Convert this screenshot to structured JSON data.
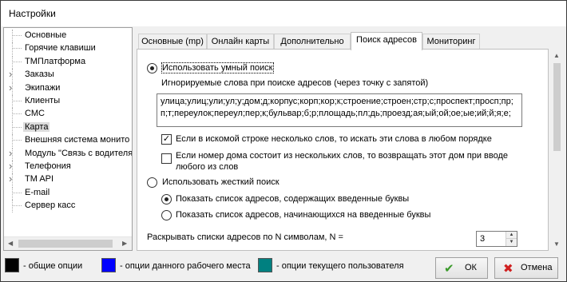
{
  "window": {
    "title": "Настройки"
  },
  "tree": {
    "items": [
      {
        "label": "Основные",
        "expandable": false
      },
      {
        "label": "Горячие клавиши",
        "expandable": false
      },
      {
        "label": "ТМПлатформа",
        "expandable": false
      },
      {
        "label": "Заказы",
        "expandable": true
      },
      {
        "label": "Экипажи",
        "expandable": true
      },
      {
        "label": "Клиенты",
        "expandable": false
      },
      {
        "label": "СМС",
        "expandable": false
      },
      {
        "label": "Карта",
        "expandable": false,
        "selected": true
      },
      {
        "label": "Внешняя система монито",
        "expandable": false
      },
      {
        "label": "Модуль \"Связь с водителя",
        "expandable": true
      },
      {
        "label": "Телефония",
        "expandable": true
      },
      {
        "label": "TM API",
        "expandable": true
      },
      {
        "label": "E-mail",
        "expandable": false
      },
      {
        "label": "Сервер касс",
        "expandable": false
      }
    ]
  },
  "tabs": [
    {
      "label": "Основные (mp)"
    },
    {
      "label": "Онлайн карты"
    },
    {
      "label": "Дополнительно"
    },
    {
      "label": "Поиск адресов",
      "active": true
    },
    {
      "label": "Мониторинг"
    }
  ],
  "search": {
    "smart_label": "Использовать умный поиск",
    "smart_checked": true,
    "ignored_label": "Игнорируемые слова при поиске адресов (через точку с запятой)",
    "ignored_value": "улица;улиц;ули;ул;у;дом;д;корпус;корп;кор;к;строение;строен;стр;с;проспект;просп;пр;п;т;переулок;переул;пер;к;бульвар;б;р;площадь;пл;дь;проезд;ая;ый;ой;ое;ые;ий;й;я;е;",
    "multi_words_label": "Если в искомой строке несколько слов, то искать эти слова в любом порядке",
    "multi_words_checked": true,
    "house_label_line1": "Если номер дома состоит из нескольких слов, то возвращать этот дом при вводе",
    "house_label_line2": "любого из слов",
    "house_checked": false,
    "strict_label": "Использовать жесткий поиск",
    "strict_checked": false,
    "contains_label": "Показать список адресов, содержащих введенные буквы",
    "contains_checked": true,
    "starts_label": "Показать список адресов, начинающихся на введенные буквы",
    "starts_checked": false,
    "expand_label": "Раскрывать списки адресов по N символам, N =",
    "expand_value": "3"
  },
  "legend": {
    "common": {
      "label": "- общие опции",
      "color": "#000000"
    },
    "workplace": {
      "label": "- опции данного рабочего места",
      "color": "#0000ff"
    },
    "user": {
      "label": "- опции текущего пользователя",
      "color": "#008080"
    }
  },
  "buttons": {
    "ok": "ОК",
    "cancel": "Отмена"
  },
  "colors": {
    "ok_icon": "#3a9a2a",
    "cancel_icon": "#d02020"
  }
}
